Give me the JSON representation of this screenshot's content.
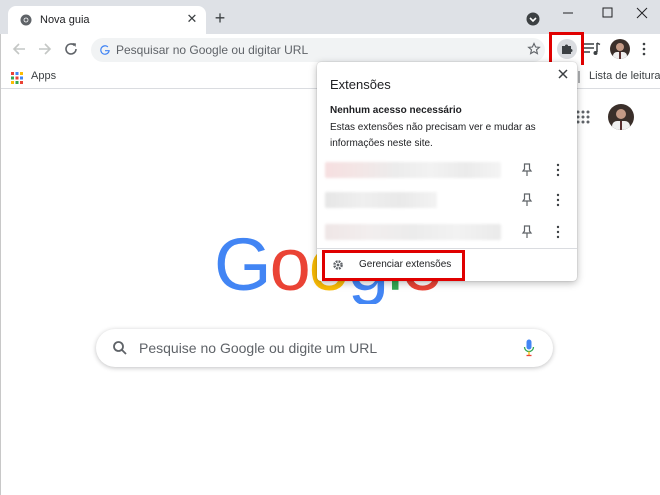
{
  "colors": {
    "highlight": "#e00000",
    "tab_strip": "#dee1e6",
    "omnibox": "#f1f3f4",
    "google_blue": "#4285f4",
    "google_red": "#ea4335",
    "google_yellow": "#fbbc05",
    "google_green": "#34a853"
  },
  "tab": {
    "title": "Nova guia",
    "favicon": "chrome-icon",
    "close_icon": "close-icon"
  },
  "toolbar": {
    "omnibox_placeholder": "Pesquisar no Google ou digitar URL",
    "icons": [
      "back-arrow-icon",
      "forward-arrow-icon",
      "reload-icon",
      "star-icon",
      "puzzle-icon",
      "reading-list-icon",
      "avatar",
      "more-vert-icon"
    ]
  },
  "bookmarks": {
    "apps_label": "Apps",
    "reading_list_label": "Lista de leitura"
  },
  "search": {
    "placeholder": "Pesquise no Google ou digite um URL"
  },
  "logo": {
    "text": "Google"
  },
  "extensions_popup": {
    "title": "Extensões",
    "section_heading": "Nenhum acesso necessário",
    "section_description": "Estas extensões não precisam ver e mudar as informações neste site.",
    "item_count": 3,
    "manage_label": "Gerenciar extensões"
  }
}
